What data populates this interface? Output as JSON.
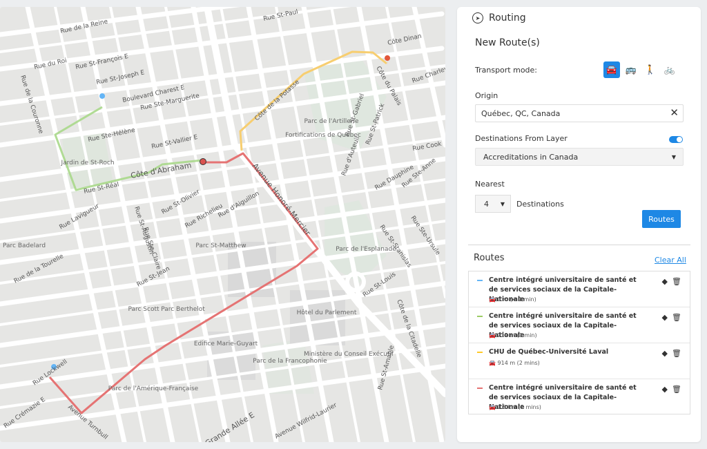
{
  "map": {
    "streets": [
      "Rue de la Reine",
      "Rue de la Couronne",
      "Rue du Roi",
      "Rue St-François E",
      "Rue St-Joseph E",
      "Boulevard Charest E",
      "Rue Ste-Marguerite",
      "Rue Ste-Hélène",
      "Rue St-Vallier E",
      "Côte d'Abraham",
      "Rue St-Réal",
      "Rue Lavigueur",
      "Rue Richelieu",
      "Rue St-Olivier",
      "Rue d'Aiguillon",
      "Rue St-Jean",
      "Rue de la Tourelle",
      "Rue Lockwell",
      "Rue Crémazie E",
      "Avenue Turnbull",
      "Grande Allée E",
      "Avenue Honoré-Mercier",
      "Côte de la Potasse",
      "Rue St-Paul",
      "Côte Dinan",
      "Côte du Palais",
      "Rue Charlevoix",
      "Rue Cook",
      "Rue Dauphine",
      "Rue d'Auteuil",
      "Rue Ste-Anne",
      "Rue St-Louis",
      "Côte de la Citadelle",
      "Rue St-Amable",
      "Avenue Wilfrid-Laurier",
      "Rue Ste-Ursule",
      "Rue St-Stanislas",
      "Rue St-Augustin",
      "Rue Ste-Claire",
      "Rue St-Gabriel",
      "Rue St-Patrick"
    ],
    "parks": [
      "Jardin de St-Roch",
      "Parc de l'Artillerie",
      "Fortifications de Québec",
      "Parc St-Matthew",
      "Parc de l'Esplanade",
      "Parc Badelard",
      "Parc Scott",
      "Parc Berthelot",
      "Hôtel du Parlement",
      "Edifice Marie-Guyart",
      "Parc de la Francophonie",
      "Ministère du Conseil Exécutif",
      "Parc de l'Amérique-Française"
    ]
  },
  "panel": {
    "title": "Routing",
    "subtitle": "New Route(s)",
    "transport_label": "Transport mode:",
    "modes": [
      {
        "icon": "car-icon",
        "glyph": "🚘",
        "active": true
      },
      {
        "icon": "bus-icon",
        "glyph": "🚌",
        "active": false
      },
      {
        "icon": "walk-icon",
        "glyph": "🚶",
        "active": false
      },
      {
        "icon": "bike-icon",
        "glyph": "🚲",
        "active": false
      }
    ],
    "origin_label": "Origin",
    "origin_value": "Québec, QC, Canada",
    "clear_glyph": "✕",
    "dest_label": "Destinations From Layer",
    "dest_value": "Accreditations in Canada",
    "nearest_label": "Nearest",
    "nearest_value": "4",
    "destinations_text": "Destinations",
    "routes_button": "Routes",
    "routes_header": "Routes",
    "clear_all": "Clear All",
    "routes": [
      {
        "color": "#64b5f6",
        "name": "Centre intégré universitaire de santé et de services sociaux de la Capitale-Nationale",
        "meta": "0 m (< 1 min)"
      },
      {
        "color": "#9ccc65",
        "name": "Centre intégré universitaire de santé et de services sociaux de la Capitale-Nationale",
        "meta": "712 m (1 min)"
      },
      {
        "color": "#ffca28",
        "name": "CHU de Québec-Université Laval",
        "meta": "914 m (2 mins)"
      },
      {
        "color": "#e57373",
        "name": "Centre intégré universitaire de santé et de services sociaux de la Capitale-Nationale",
        "meta": "1.5 km (2 mins)"
      }
    ]
  }
}
